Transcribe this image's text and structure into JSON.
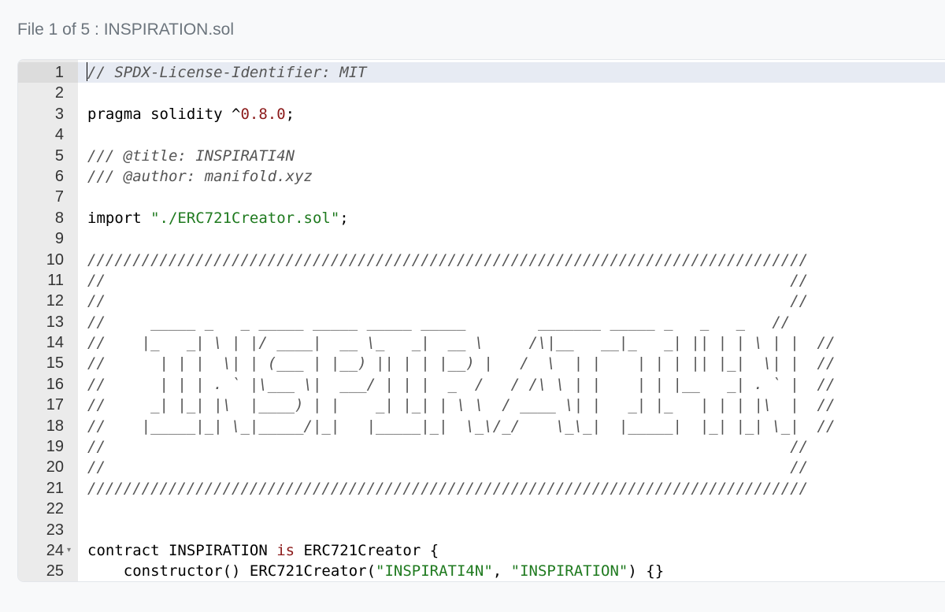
{
  "file_header": "File 1 of 5 : INSPIRATION.sol",
  "lines": [
    {
      "n": "1",
      "parts": [
        {
          "t": "// SPDX-License-Identifier: MIT",
          "c": "comment"
        }
      ]
    },
    {
      "n": "2",
      "parts": []
    },
    {
      "n": "3",
      "parts": [
        {
          "t": "pragma solidity ^",
          "c": "keyword"
        },
        {
          "t": "0.8.0",
          "c": "number"
        },
        {
          "t": ";",
          "c": "keyword"
        }
      ]
    },
    {
      "n": "4",
      "parts": []
    },
    {
      "n": "5",
      "parts": [
        {
          "t": "/// @title: INSPIRATI4N",
          "c": "comment"
        }
      ]
    },
    {
      "n": "6",
      "parts": [
        {
          "t": "/// @author: manifold.xyz",
          "c": "comment"
        }
      ]
    },
    {
      "n": "7",
      "parts": []
    },
    {
      "n": "8",
      "parts": [
        {
          "t": "import ",
          "c": "keyword"
        },
        {
          "t": "\"./ERC721Creator.sol\"",
          "c": "string"
        },
        {
          "t": ";",
          "c": "keyword"
        }
      ]
    },
    {
      "n": "9",
      "parts": []
    },
    {
      "n": "10",
      "parts": [
        {
          "t": "////////////////////////////////////////////////////////////////////////////////",
          "c": "comment"
        }
      ]
    },
    {
      "n": "11",
      "parts": [
        {
          "t": "//                                                                            //",
          "c": "comment"
        }
      ]
    },
    {
      "n": "12",
      "parts": [
        {
          "t": "//                                                                            //",
          "c": "comment"
        }
      ]
    },
    {
      "n": "13",
      "parts": [
        {
          "t": "//     _____ _   _ _____ _____ _____ _____        _______ _____ _   _   _   //",
          "c": "comment"
        }
      ]
    },
    {
      "n": "14",
      "parts": [
        {
          "t": "//    |_   _| \\ | |/ ____|  __ \\_   _|  __ \\     /\\|__   __|_   _| || | | \\ | |  //",
          "c": "comment"
        }
      ]
    },
    {
      "n": "15",
      "parts": [
        {
          "t": "//      | | |  \\| | (___ | |__) || | | |__) |   /  \\  | |    | | | || |_|  \\| |  //",
          "c": "comment"
        }
      ]
    },
    {
      "n": "16",
      "parts": [
        {
          "t": "//      | | | . ` |\\___ \\|  ___/ | | |  _  /   / /\\ \\ | |    | | |__   _| . ` |  //",
          "c": "comment"
        }
      ]
    },
    {
      "n": "17",
      "parts": [
        {
          "t": "//     _| |_| |\\  |____) | |    _| |_| | \\ \\  / ____ \\| |   _| |_   | | | |\\  |  //",
          "c": "comment"
        }
      ]
    },
    {
      "n": "18",
      "parts": [
        {
          "t": "//    |_____|_| \\_|_____/|_|   |_____|_|  \\_\\/_/    \\_\\_|  |_____|  |_| |_| \\_|  //",
          "c": "comment"
        }
      ]
    },
    {
      "n": "19",
      "parts": [
        {
          "t": "//                                                                            //",
          "c": "comment"
        }
      ]
    },
    {
      "n": "20",
      "parts": [
        {
          "t": "//                                                                            //",
          "c": "comment"
        }
      ]
    },
    {
      "n": "21",
      "parts": [
        {
          "t": "////////////////////////////////////////////////////////////////////////////////",
          "c": "comment"
        }
      ]
    },
    {
      "n": "22",
      "parts": []
    },
    {
      "n": "23",
      "parts": []
    },
    {
      "n": "24",
      "fold": true,
      "parts": [
        {
          "t": "contract INSPIRATION ",
          "c": "keyword"
        },
        {
          "t": "is",
          "c": "is"
        },
        {
          "t": " ERC721Creator {",
          "c": "keyword"
        }
      ]
    },
    {
      "n": "25",
      "parts": [
        {
          "t": "    constructor() ERC721Creator(",
          "c": "keyword"
        },
        {
          "t": "\"INSPIRATI4N\"",
          "c": "string"
        },
        {
          "t": ", ",
          "c": "keyword"
        },
        {
          "t": "\"INSPIRATION\"",
          "c": "string"
        },
        {
          "t": ") {}",
          "c": "keyword"
        }
      ]
    }
  ]
}
